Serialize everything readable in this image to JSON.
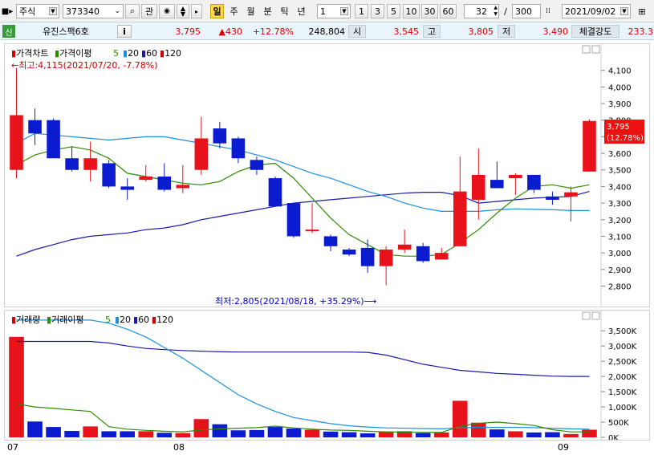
{
  "toolbar": {
    "market": "주식",
    "code": "373340",
    "btn_related": "관",
    "period_tabs": [
      "일",
      "주",
      "월",
      "분",
      "틱",
      "년"
    ],
    "selected_period": "일",
    "interval_value": "1",
    "quick_intervals": [
      "1",
      "3",
      "5",
      "10",
      "30",
      "60"
    ],
    "count_value": "32",
    "slash": "/",
    "total_value": "300",
    "date_value": "2021/09/02"
  },
  "quote": {
    "badge": "신",
    "name": "유진스팩6호",
    "info_button": "i",
    "price": "3,795",
    "change": "▲430",
    "change_pct": "+12.78%",
    "volume": "248,804",
    "open_label": "시",
    "open": "3,545",
    "high_label": "고",
    "high": "3,805",
    "low_label": "저",
    "low": "3,490",
    "strength_label": "체결강도",
    "strength": "233.3"
  },
  "price_panel": {
    "legend": [
      "가격차트",
      "가격이평",
      "5",
      "20",
      "60",
      "120"
    ],
    "high_note": "←최고:4,115(2021/07/20, -7.78%)",
    "low_note": "최저:2,805(2021/08/18, +35.29%)⟶",
    "current_price_label": "3,795",
    "current_pct_label": "(12.78%)",
    "colors": {
      "up": "#e8121a",
      "down": "#0a1bd0",
      "ma5": "#2e8b00",
      "ma20": "#1b8fe0",
      "ma60": "#1a1aa8",
      "ma120": "#cc0000"
    }
  },
  "volume_panel": {
    "legend": [
      "거래량",
      "거래이평",
      "5",
      "20",
      "60",
      "120"
    ]
  },
  "x_axis_labels": [
    "07",
    "08",
    "09"
  ],
  "chart_data": {
    "type": "candlestick",
    "price_ylim": [
      2720,
      4200
    ],
    "price_ticks": [
      "4,100",
      "4,000",
      "3,900",
      "3,800",
      "3,700",
      "3,600",
      "3,500",
      "3,400",
      "3,300",
      "3,200",
      "3,100",
      "3,000",
      "2,900",
      "2,800"
    ],
    "volume_ylim": [
      0,
      3900
    ],
    "volume_ticks": [
      "3,500K",
      "3,000K",
      "2,500K",
      "2,000K",
      "1,500K",
      "1,000K",
      "500K",
      "0K"
    ],
    "candles": [
      {
        "o": 3500,
        "h": 4115,
        "l": 3450,
        "c": 3830
      },
      {
        "o": 3800,
        "h": 3870,
        "l": 3650,
        "c": 3720
      },
      {
        "o": 3800,
        "h": 3810,
        "l": 3590,
        "c": 3570
      },
      {
        "o": 3570,
        "h": 3640,
        "l": 3490,
        "c": 3500
      },
      {
        "o": 3500,
        "h": 3670,
        "l": 3430,
        "c": 3570
      },
      {
        "o": 3540,
        "h": 3560,
        "l": 3390,
        "c": 3400
      },
      {
        "o": 3400,
        "h": 3450,
        "l": 3320,
        "c": 3380
      },
      {
        "o": 3440,
        "h": 3530,
        "l": 3430,
        "c": 3460
      },
      {
        "o": 3460,
        "h": 3540,
        "l": 3370,
        "c": 3380
      },
      {
        "o": 3390,
        "h": 3530,
        "l": 3360,
        "c": 3410
      },
      {
        "o": 3500,
        "h": 3820,
        "l": 3470,
        "c": 3690
      },
      {
        "o": 3750,
        "h": 3790,
        "l": 3630,
        "c": 3660
      },
      {
        "o": 3690,
        "h": 3700,
        "l": 3540,
        "c": 3570
      },
      {
        "o": 3560,
        "h": 3580,
        "l": 3470,
        "c": 3500
      },
      {
        "o": 3450,
        "h": 3460,
        "l": 3280,
        "c": 3280
      },
      {
        "o": 3300,
        "h": 3300,
        "l": 3090,
        "c": 3100
      },
      {
        "o": 3130,
        "h": 3300,
        "l": 3120,
        "c": 3140
      },
      {
        "o": 3100,
        "h": 3110,
        "l": 3010,
        "c": 3040
      },
      {
        "o": 3020,
        "h": 3030,
        "l": 2980,
        "c": 2990
      },
      {
        "o": 3030,
        "h": 3080,
        "l": 2880,
        "c": 2920
      },
      {
        "o": 2920,
        "h": 3040,
        "l": 2805,
        "c": 3020
      },
      {
        "o": 3020,
        "h": 3140,
        "l": 3000,
        "c": 3050
      },
      {
        "o": 3040,
        "h": 3060,
        "l": 2940,
        "c": 2950
      },
      {
        "o": 2960,
        "h": 3030,
        "l": 2960,
        "c": 3000
      },
      {
        "o": 3040,
        "h": 3580,
        "l": 3040,
        "c": 3370
      },
      {
        "o": 3320,
        "h": 3630,
        "l": 3200,
        "c": 3470
      },
      {
        "o": 3440,
        "h": 3550,
        "l": 3390,
        "c": 3390
      },
      {
        "o": 3450,
        "h": 3480,
        "l": 3350,
        "c": 3470
      },
      {
        "o": 3470,
        "h": 3470,
        "l": 3360,
        "c": 3380
      },
      {
        "o": 3340,
        "h": 3370,
        "l": 3290,
        "c": 3320
      },
      {
        "o": 3340,
        "h": 3400,
        "l": 3190,
        "c": 3365
      },
      {
        "o": 3490,
        "h": 3805,
        "l": 3490,
        "c": 3795
      }
    ],
    "volume_k": [
      3300,
      520,
      340,
      210,
      360,
      200,
      200,
      200,
      150,
      140,
      600,
      430,
      230,
      240,
      340,
      290,
      250,
      190,
      170,
      130,
      190,
      200,
      140,
      160,
      1200,
      480,
      260,
      200,
      160,
      170,
      110,
      250
    ],
    "ma5": [
      3530,
      3590,
      3620,
      3640,
      3620,
      3570,
      3480,
      3460,
      3440,
      3420,
      3410,
      3430,
      3490,
      3530,
      3540,
      3450,
      3330,
      3210,
      3110,
      3050,
      2990,
      2980,
      2980,
      2990,
      3060,
      3140,
      3240,
      3330,
      3400,
      3410,
      3390,
      3410
    ],
    "ma20": [
      3660,
      3720,
      3710,
      3700,
      3690,
      3680,
      3690,
      3700,
      3700,
      3680,
      3660,
      3640,
      3620,
      3590,
      3560,
      3520,
      3480,
      3450,
      3410,
      3370,
      3340,
      3300,
      3270,
      3250,
      3250,
      3250,
      3260,
      3265,
      3262,
      3260,
      3255,
      3255
    ],
    "ma60": [
      2980,
      3020,
      3050,
      3080,
      3100,
      3110,
      3120,
      3140,
      3150,
      3170,
      3200,
      3220,
      3240,
      3260,
      3280,
      3300,
      3310,
      3320,
      3330,
      3340,
      3350,
      3360,
      3365,
      3365,
      3345,
      3300,
      3310,
      3320,
      3330,
      3335,
      3340,
      3370
    ],
    "vol_ma5": [
      1100,
      1000,
      950,
      900,
      850,
      350,
      270,
      230,
      200,
      180,
      240,
      280,
      300,
      320,
      370,
      310,
      270,
      240,
      230,
      200,
      180,
      170,
      160,
      160,
      360,
      460,
      500,
      450,
      390,
      250,
      180,
      180
    ],
    "vol_ma20": [
      3850,
      3850,
      3850,
      3850,
      3850,
      3750,
      3550,
      3300,
      2950,
      2600,
      2200,
      1800,
      1400,
      1100,
      850,
      650,
      550,
      450,
      380,
      340,
      310,
      300,
      290,
      280,
      310,
      330,
      330,
      330,
      320,
      300,
      280,
      270
    ],
    "vol_ma60": [
      3150,
      3150,
      3150,
      3150,
      3150,
      3100,
      3000,
      2920,
      2880,
      2850,
      2830,
      2810,
      2800,
      2800,
      2800,
      2800,
      2800,
      2800,
      2800,
      2790,
      2700,
      2550,
      2400,
      2300,
      2200,
      2150,
      2100,
      2070,
      2040,
      2010,
      2000,
      2000
    ]
  }
}
